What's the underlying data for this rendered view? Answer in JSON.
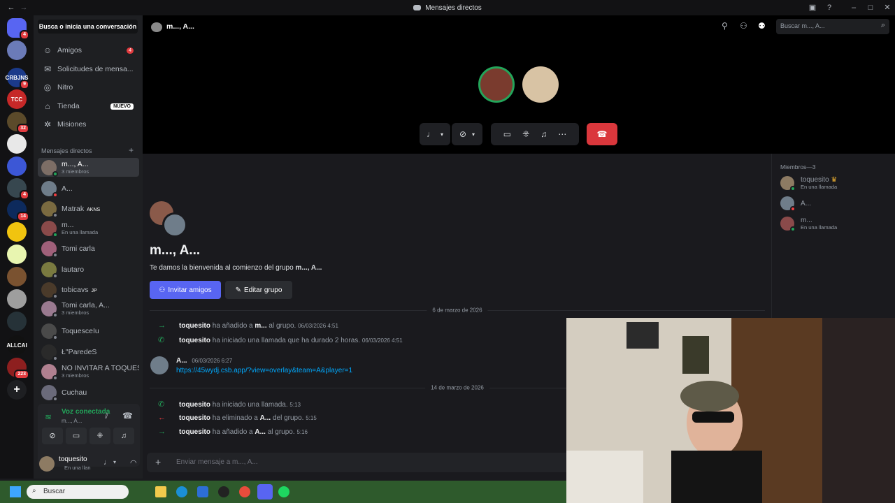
{
  "window": {
    "title": "Mensajes directos"
  },
  "servers": [
    {
      "label": "",
      "badge": "4",
      "color": "#5865f2"
    },
    {
      "label": "",
      "badge": "",
      "color": "#6b7bb8"
    },
    {
      "label": "CRBJNS",
      "badge": "9",
      "color": "#1b3a8a"
    },
    {
      "label": "TCC",
      "badge": "",
      "color": "#c62828"
    },
    {
      "label": "",
      "badge": "32",
      "color": "#5b4a2a"
    },
    {
      "label": "",
      "badge": "",
      "color": "#e8e8e8"
    },
    {
      "label": "",
      "badge": "",
      "color": "#3c57d6"
    },
    {
      "label": "",
      "badge": "4",
      "color": "#37474f"
    },
    {
      "label": "",
      "badge": "14",
      "color": "#0d2a5c"
    },
    {
      "label": "",
      "badge": "",
      "color": "#f1c40f"
    },
    {
      "label": "",
      "badge": "",
      "color": "#e8f5b0"
    },
    {
      "label": "",
      "badge": "",
      "color": "#7a5230"
    },
    {
      "label": "",
      "badge": "",
      "color": "#9e9e9e"
    },
    {
      "label": "",
      "badge": "",
      "color": "#263238"
    },
    {
      "label": "ALLCAI",
      "badge": "",
      "color": "#111111"
    },
    {
      "label": "",
      "badge": "223",
      "color": "#8d1f1f"
    }
  ],
  "sidebar": {
    "search": "Busca o inicia una conversación",
    "nav": [
      {
        "label": "Amigos",
        "badge": "4",
        "tag": ""
      },
      {
        "label": "Solicitudes de mensa...",
        "badge": "",
        "tag": ""
      },
      {
        "label": "Nitro",
        "badge": "",
        "tag": ""
      },
      {
        "label": "Tienda",
        "badge": "",
        "tag": "NUEVO"
      },
      {
        "label": "Misiones",
        "badge": "",
        "tag": ""
      }
    ],
    "dm_header": "Mensajes directos",
    "dms": [
      {
        "name": "m..., A...",
        "sub": "3 miembros",
        "tag": ""
      },
      {
        "name": "A...",
        "sub": "",
        "tag": ""
      },
      {
        "name": "Matrak",
        "sub": "",
        "tag": "AKNS"
      },
      {
        "name": "m...",
        "sub": "En una llamada",
        "tag": ""
      },
      {
        "name": "Tomi carla",
        "sub": "",
        "tag": ""
      },
      {
        "name": "lautaro",
        "sub": "",
        "tag": ""
      },
      {
        "name": "tobicavs",
        "sub": "",
        "tag": "JP"
      },
      {
        "name": "Tomi carla, A...",
        "sub": "3 miembros",
        "tag": ""
      },
      {
        "name": "ToquesceIu",
        "sub": "",
        "tag": ""
      },
      {
        "name": "Ł\"ParedeS",
        "sub": "",
        "tag": ""
      },
      {
        "name": "NO INVITAR A TOQUES",
        "sub": "3 miembros",
        "tag": ""
      },
      {
        "name": "Cuchau",
        "sub": "",
        "tag": ""
      }
    ],
    "voice": {
      "status": "Voz conectada",
      "channel": "m..., A..."
    },
    "user": {
      "name": "toquesito",
      "status": "En una llan"
    }
  },
  "header": {
    "title": "m..., A...",
    "search_placeholder": "Buscar m..., A..."
  },
  "chat": {
    "group_title": "m..., A...",
    "welcome_prefix": "Te damos la bienvenida al comienzo del grupo ",
    "welcome_group": "m..., A...",
    "invite_button": "Invitar amigos",
    "edit_button": "Editar grupo",
    "date1": "6 de marzo de 2026",
    "date2": "14 de marzo de 2026",
    "events1": [
      {
        "user": "toquesito",
        "text": " ha añadido a ",
        "target": "m...",
        "tail": " al grupo.",
        "time": "06/03/2026 4:51",
        "color": "#23a55a",
        "arrow": "→"
      },
      {
        "user": "toquesito",
        "text": " ha iniciado una llamada que ha durado 2 horas.",
        "target": "",
        "tail": "",
        "time": "06/03/2026 4:51",
        "color": "#23a55a",
        "arrow": "✆"
      }
    ],
    "message": {
      "author": "A...",
      "time": "06/03/2026 6:27",
      "link": "https://45wydj.csb.app/?view=overlay&team=A&player=1"
    },
    "events2": [
      {
        "user": "toquesito",
        "text": " ha iniciado una llamada.",
        "target": "",
        "tail": "",
        "time": "5:13",
        "color": "#23a55a",
        "arrow": "✆"
      },
      {
        "user": "toquesito",
        "text": " ha eliminado a ",
        "target": "A...",
        "tail": " del grupo.",
        "time": "5:15",
        "color": "#f23f43",
        "arrow": "←"
      },
      {
        "user": "toquesito",
        "text": " ha añadido a ",
        "target": "A...",
        "tail": " al grupo.",
        "time": "5:16",
        "color": "#23a55a",
        "arrow": "→"
      }
    ],
    "composer_placeholder": "Enviar mensaje a m..., A..."
  },
  "members": {
    "header": "Miembros—3",
    "list": [
      {
        "name": "toquesito",
        "sub": "En una llamada",
        "crown": "♛"
      },
      {
        "name": "A...",
        "sub": "",
        "crown": ""
      },
      {
        "name": "m...",
        "sub": "En una llamada",
        "crown": ""
      }
    ]
  },
  "taskbar": {
    "search": "Buscar"
  }
}
